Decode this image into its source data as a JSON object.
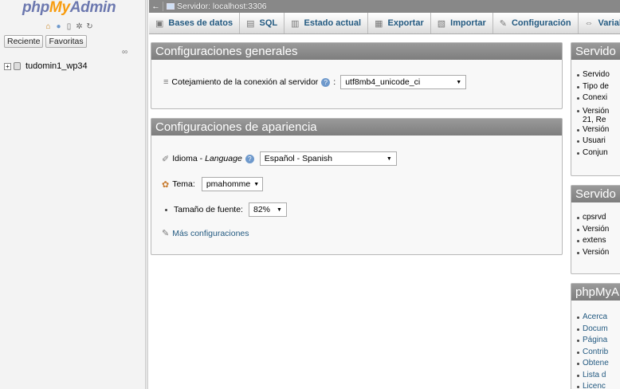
{
  "nav": {
    "logo_php": "php",
    "logo_my": "My",
    "logo_admin": "Admin",
    "tabs": [
      "Reciente",
      "Favoritas"
    ],
    "databases": [
      {
        "name": "tudomin1_wp34"
      }
    ]
  },
  "serverbar": {
    "back": "←",
    "server_label": "Servidor: localhost:3306"
  },
  "menu": {
    "items": [
      {
        "label": "Bases de datos",
        "icon": "database-icon"
      },
      {
        "label": "SQL",
        "icon": "sql-icon"
      },
      {
        "label": "Estado actual",
        "icon": "status-icon"
      },
      {
        "label": "Exportar",
        "icon": "export-icon"
      },
      {
        "label": "Importar",
        "icon": "import-icon"
      },
      {
        "label": "Configuración",
        "icon": "wrench-icon"
      },
      {
        "label": "Variab",
        "icon": "variables-icon"
      }
    ]
  },
  "general": {
    "title": "Configuraciones generales",
    "collation_label": "Cotejamiento de la conexión al servidor",
    "collation_colon": ":",
    "collation_value": "utf8mb4_unicode_ci"
  },
  "appearance": {
    "title": "Configuraciones de apariencia",
    "language_label": "Idioma",
    "language_sep": " - ",
    "language_en": "Language",
    "language_value": "Español - Spanish",
    "theme_label": "Tema:",
    "theme_value": "pmahomme",
    "font_label": "Tamaño de fuente:",
    "font_value": "82%",
    "more_settings": "Más configuraciones"
  },
  "db_server": {
    "title": "Servido",
    "items": [
      "Servido",
      "Tipo de",
      "Conexi",
      "Versión",
      "21, Re",
      "Versión",
      "Usuari",
      "Conjun"
    ]
  },
  "web_server": {
    "title": "Servido",
    "items": [
      "cpsrvd",
      "Versión",
      "extens",
      "Versión"
    ]
  },
  "pma": {
    "title": "phpMyA",
    "items": [
      "Acerca",
      "Docum",
      "Página",
      "Contrib",
      "Obtene",
      "Lista d",
      "Licenc"
    ]
  }
}
